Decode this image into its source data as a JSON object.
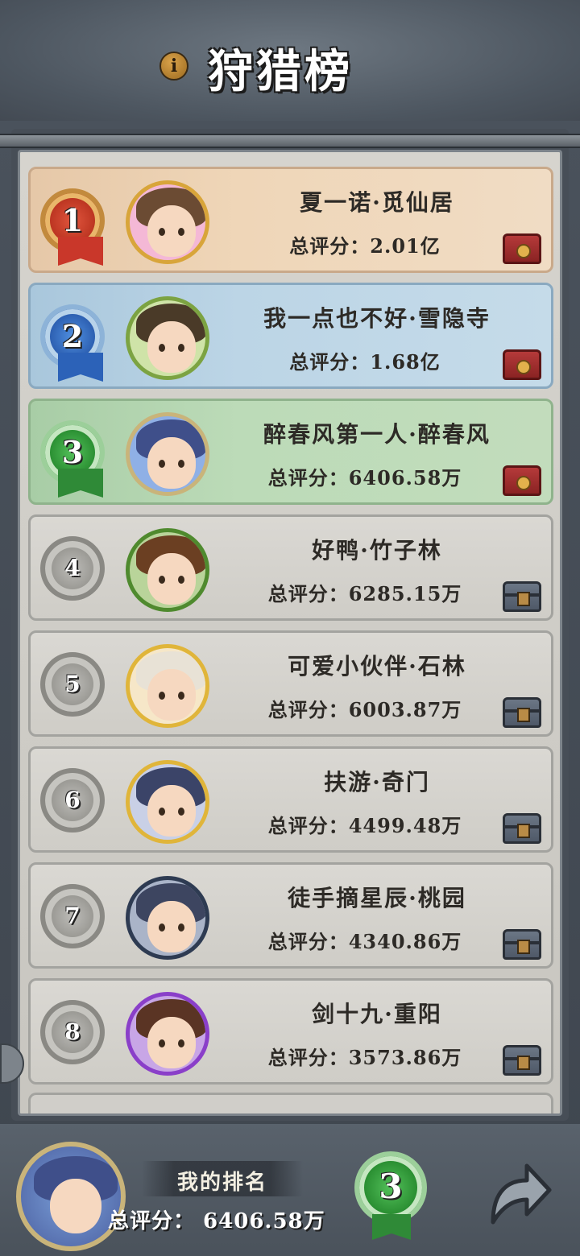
{
  "header": {
    "title": "狩猎榜",
    "info_icon": "i"
  },
  "rows": [
    {
      "rank": "1",
      "name": "夏一诺·觅仙居",
      "score": "总评分：2.01亿",
      "badge": "gold",
      "chest": "red",
      "frame_color": "#d8a53a",
      "hair_color": "#6b4b33",
      "avatar_bg": "#f4b8d6"
    },
    {
      "rank": "2",
      "name": "我一点也不好·雪隐寺",
      "score": "总评分：1.68亿",
      "badge": "blue",
      "chest": "red",
      "frame_color": "#7ca342",
      "hair_color": "#4a3a28",
      "avatar_bg": "#cfe3a8"
    },
    {
      "rank": "3",
      "name": "醉春风第一人·醉春风",
      "score": "总评分：6406.58万",
      "badge": "green",
      "chest": "red",
      "frame_color": "#c9b47a",
      "hair_color": "#3f4f8a",
      "avatar_bg": "#8fb0e6"
    },
    {
      "rank": "4",
      "name": "好鸭·竹子林",
      "score": "总评分：6285.15万",
      "badge": "grey",
      "chest": "grey",
      "frame_color": "#4f8a2e",
      "hair_color": "#6b3f22",
      "avatar_bg": "#b9d49a"
    },
    {
      "rank": "5",
      "name": "可爱小伙伴·石林",
      "score": "总评分：6003.87万",
      "badge": "grey",
      "chest": "grey",
      "frame_color": "#e0b53a",
      "hair_color": "#e8e2d6",
      "avatar_bg": "#f6e7c8"
    },
    {
      "rank": "6",
      "name": "扶游·奇门",
      "score": "总评分：4499.48万",
      "badge": "grey",
      "chest": "grey",
      "frame_color": "#e0b53a",
      "hair_color": "#3b4468",
      "avatar_bg": "#c9d0e6"
    },
    {
      "rank": "7",
      "name": "徒手摘星辰·桃园",
      "score": "总评分：4340.86万",
      "badge": "grey",
      "chest": "grey",
      "frame_color": "#2e3b52",
      "hair_color": "#3d4560",
      "avatar_bg": "#aab4c8"
    },
    {
      "rank": "8",
      "name": "剑十九·重阳",
      "score": "总评分：3573.86万",
      "badge": "grey",
      "chest": "grey",
      "frame_color": "#8a3fc9",
      "hair_color": "#5a3424",
      "avatar_bg": "#c8a6e6"
    }
  ],
  "footer": {
    "my_rank_label": "我的排名",
    "my_score": "总评分： 6406.58万",
    "my_rank": "3"
  },
  "colors": {
    "accent_gold": "#c9372a",
    "accent_blue": "#2c62b8",
    "accent_green": "#2f8a37"
  }
}
